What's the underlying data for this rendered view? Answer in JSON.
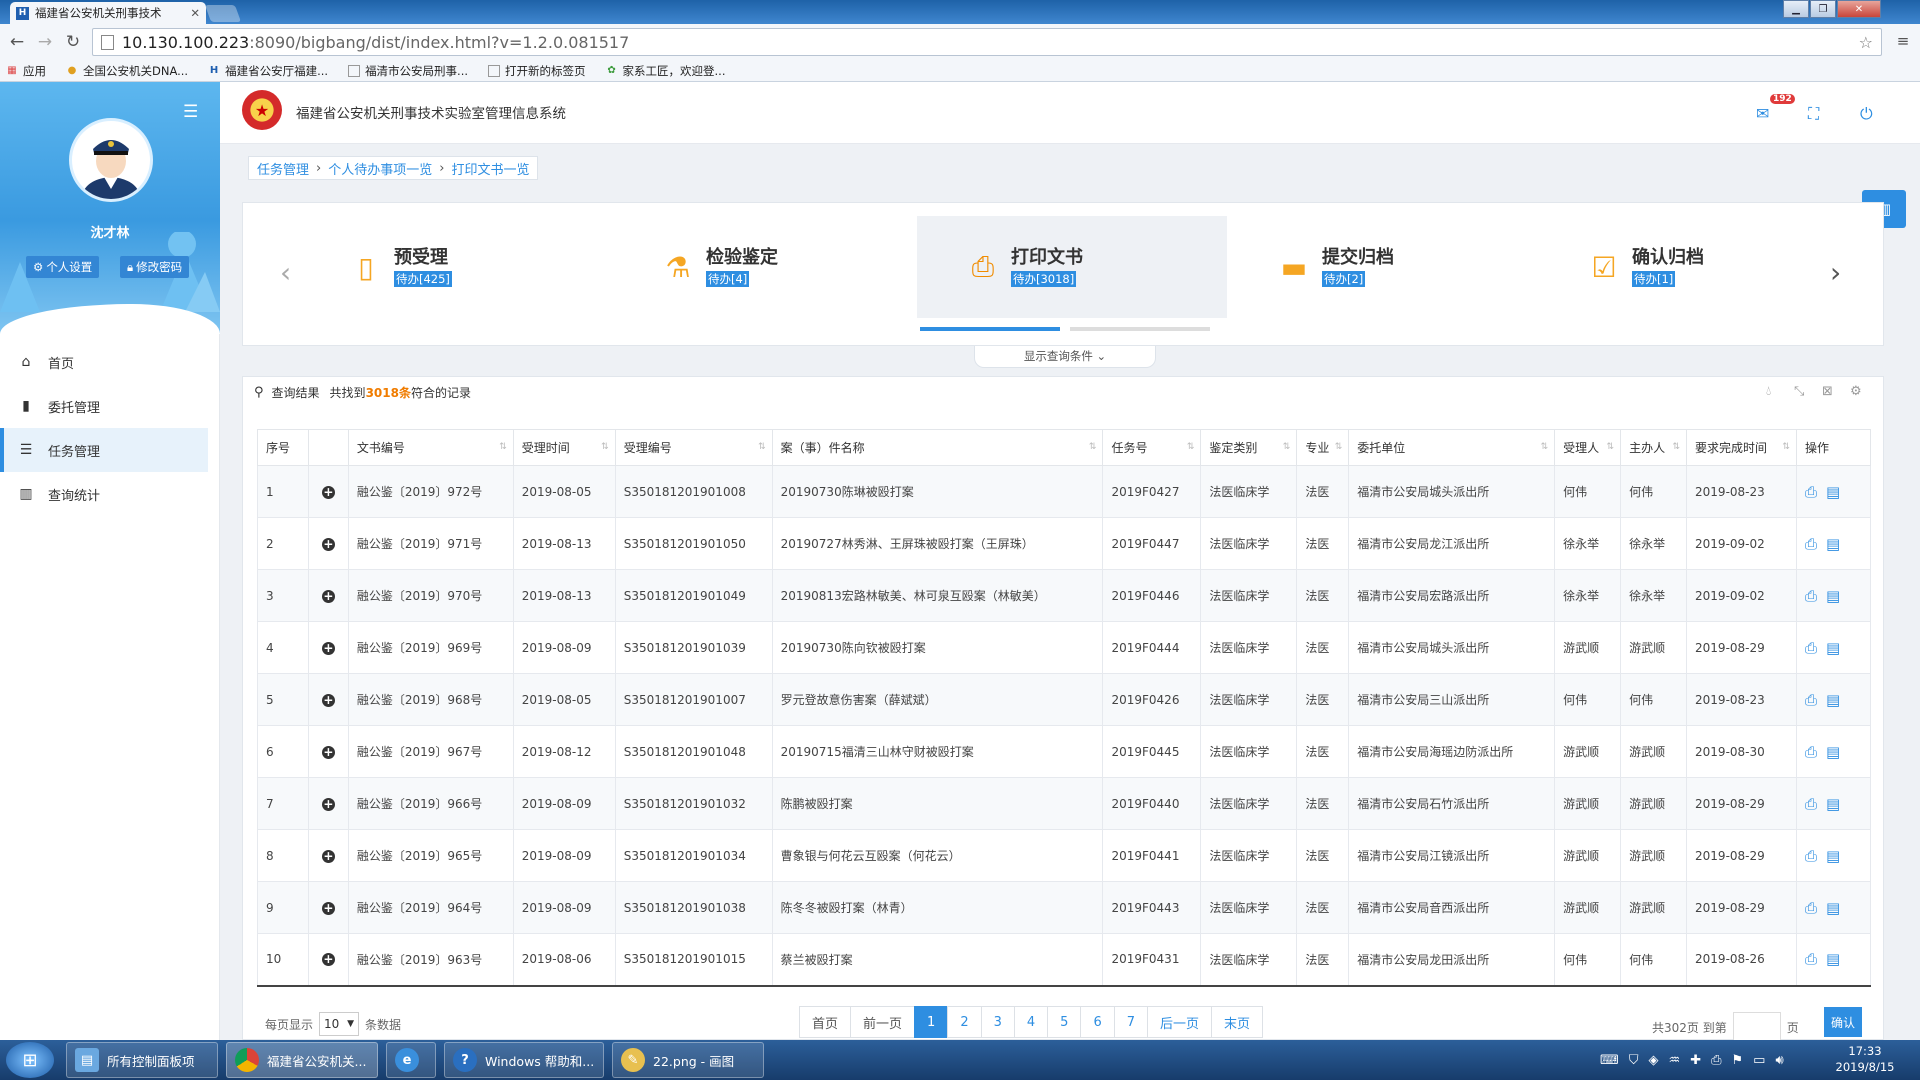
{
  "browser": {
    "tab_title": "福建省公安机关刑事技术",
    "url_host": "10.130.100.223",
    "url_rest": ":8090/bigbang/dist/index.html?v=1.2.0.081517",
    "bookmarks": [
      "应用",
      "全国公安机关DNA...",
      "福建省公安厅福建...",
      "福清市公安局刑事...",
      "打开新的标签页",
      "家系工匠，欢迎登..."
    ]
  },
  "sidebar": {
    "user_name": "沈才林",
    "btn_settings": "个人设置",
    "btn_password": "修改密码",
    "menu": [
      "首页",
      "委托管理",
      "任务管理",
      "查询统计"
    ]
  },
  "header": {
    "system_title": "福建省公安机关刑事技术实验室管理信息系统",
    "mail_count": "192"
  },
  "breadcrumb": [
    "任务管理",
    "个人待办事项一览",
    "打印文书一览"
  ],
  "steps": [
    {
      "title": "预受理",
      "badge": "待办[425]"
    },
    {
      "title": "检验鉴定",
      "badge": "待办[4]"
    },
    {
      "title": "打印文书",
      "badge": "待办[3018]"
    },
    {
      "title": "提交归档",
      "badge": "待办[2]"
    },
    {
      "title": "确认归档",
      "badge": "待办[1]"
    }
  ],
  "toggle_label": "显示查询条件",
  "result": {
    "label": "查询结果",
    "pre": "共找到",
    "count": "3018条",
    "post": "符合的记录"
  },
  "table": {
    "headers": [
      "序号",
      "",
      "文书编号",
      "受理时间",
      "受理编号",
      "案（事）件名称",
      "任务号",
      "鉴定类别",
      "专业",
      "委托单位",
      "受理人",
      "主办人",
      "要求完成时间",
      "操作"
    ],
    "rows": [
      [
        "1",
        "融公鉴〔2019〕972号",
        "2019-08-05",
        "S350181201901008",
        "20190730陈琳被殴打案",
        "2019F0427",
        "法医临床学",
        "法医",
        "福清市公安局城头派出所",
        "何伟",
        "何伟",
        "2019-08-23"
      ],
      [
        "2",
        "融公鉴〔2019〕971号",
        "2019-08-13",
        "S350181201901050",
        "20190727林秀淋、王屏珠被殴打案（王屏珠）",
        "2019F0447",
        "法医临床学",
        "法医",
        "福清市公安局龙江派出所",
        "徐永举",
        "徐永举",
        "2019-09-02"
      ],
      [
        "3",
        "融公鉴〔2019〕970号",
        "2019-08-13",
        "S350181201901049",
        "20190813宏路林敏美、林可泉互殴案（林敏美）",
        "2019F0446",
        "法医临床学",
        "法医",
        "福清市公安局宏路派出所",
        "徐永举",
        "徐永举",
        "2019-09-02"
      ],
      [
        "4",
        "融公鉴〔2019〕969号",
        "2019-08-09",
        "S350181201901039",
        "20190730陈向钦被殴打案",
        "2019F0444",
        "法医临床学",
        "法医",
        "福清市公安局城头派出所",
        "游武顺",
        "游武顺",
        "2019-08-29"
      ],
      [
        "5",
        "融公鉴〔2019〕968号",
        "2019-08-05",
        "S350181201901007",
        "罗元登故意伤害案（薛斌斌）",
        "2019F0426",
        "法医临床学",
        "法医",
        "福清市公安局三山派出所",
        "何伟",
        "何伟",
        "2019-08-23"
      ],
      [
        "6",
        "融公鉴〔2019〕967号",
        "2019-08-12",
        "S350181201901048",
        "20190715福清三山林守财被殴打案",
        "2019F0445",
        "法医临床学",
        "法医",
        "福清市公安局海瑶边防派出所",
        "游武顺",
        "游武顺",
        "2019-08-30"
      ],
      [
        "7",
        "融公鉴〔2019〕966号",
        "2019-08-09",
        "S350181201901032",
        "陈鹏被殴打案",
        "2019F0440",
        "法医临床学",
        "法医",
        "福清市公安局石竹派出所",
        "游武顺",
        "游武顺",
        "2019-08-29"
      ],
      [
        "8",
        "融公鉴〔2019〕965号",
        "2019-08-09",
        "S350181201901034",
        "曹象银与何花云互殴案（何花云）",
        "2019F0441",
        "法医临床学",
        "法医",
        "福清市公安局江镜派出所",
        "游武顺",
        "游武顺",
        "2019-08-29"
      ],
      [
        "9",
        "融公鉴〔2019〕964号",
        "2019-08-09",
        "S350181201901038",
        "陈冬冬被殴打案（林青）",
        "2019F0443",
        "法医临床学",
        "法医",
        "福清市公安局音西派出所",
        "游武顺",
        "游武顺",
        "2019-08-29"
      ],
      [
        "10",
        "融公鉴〔2019〕963号",
        "2019-08-06",
        "S350181201901015",
        "蔡兰被殴打案",
        "2019F0431",
        "法医临床学",
        "法医",
        "福清市公安局龙田派出所",
        "何伟",
        "何伟",
        "2019-08-26"
      ]
    ]
  },
  "pagination": {
    "per_page_label": "每页显示",
    "per_page": "10",
    "per_page_suffix": "条数据",
    "first": "首页",
    "prev": "前一页",
    "pages": [
      "1",
      "2",
      "3",
      "4",
      "5",
      "6",
      "7"
    ],
    "next": "后一页",
    "last": "末页",
    "total_label": "共302页 到第",
    "page_suffix": "页",
    "confirm": "确认"
  },
  "taskbar": {
    "items": [
      "所有控制面板项",
      "福建省公安机关...",
      "",
      "Windows 帮助和...",
      "22.png - 画图"
    ],
    "time": "17:33",
    "date": "2019/8/15"
  },
  "colors": {
    "accent": "#2e8ee1",
    "highlight": "#f07c00",
    "sidebar_top": "#4aa8e8"
  }
}
